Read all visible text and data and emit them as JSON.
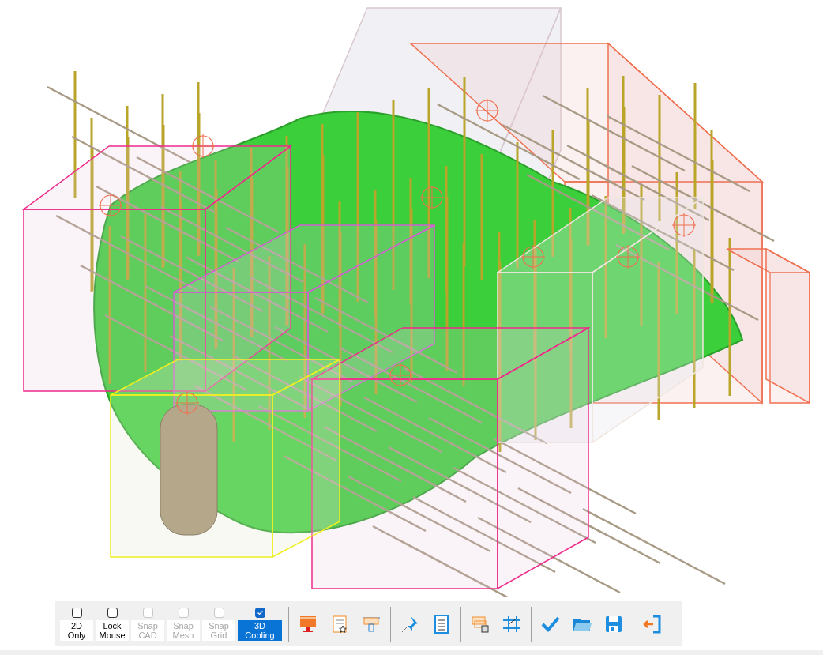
{
  "toolbar": {
    "toggles": [
      {
        "label": "2D Only",
        "checked": false,
        "disabled": false
      },
      {
        "label": "Lock Mouse",
        "checked": false,
        "disabled": false
      },
      {
        "label": "Snap CAD",
        "checked": false,
        "disabled": true
      },
      {
        "label": "Snap Mesh",
        "checked": false,
        "disabled": true
      },
      {
        "label": "Snap Grid",
        "checked": false,
        "disabled": true
      },
      {
        "label": "3D Cooling",
        "checked": true,
        "disabled": false
      }
    ]
  }
}
